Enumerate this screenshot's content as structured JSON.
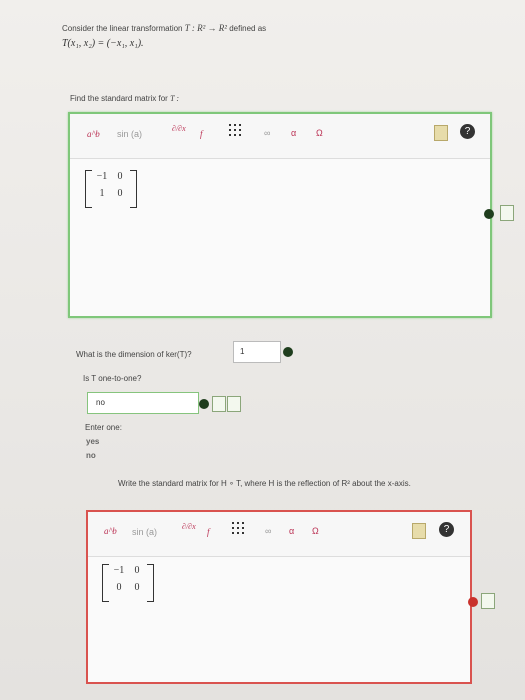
{
  "q1": {
    "intro": "Consider the linear transformation",
    "map": "T : R² → R²",
    "defined_as": "defined as",
    "rule": "T(x₁, x₂) = (−x₁, x₁)."
  },
  "q2": {
    "prompt": "Find the standard matrix for",
    "symbol": "T :"
  },
  "toolbar": {
    "power": "a^b",
    "sin": "sin (a)",
    "deriv": "∂/∂x",
    "f": "f",
    "infinity": "∞",
    "alpha": "α",
    "omega": "Ω",
    "help": "?"
  },
  "matrix1": {
    "r1c1": "−1",
    "r1c2": "0",
    "r2c1": "1",
    "r2c2": "0"
  },
  "q3": {
    "prompt": "What is the dimension of ker(T)?",
    "answer": "1"
  },
  "q4": {
    "prompt": "Is T one-to-one?",
    "answer": "no",
    "enter_one": "Enter one:",
    "opt_yes": "yes",
    "opt_no": "no"
  },
  "q5": {
    "prompt": "Write the standard matrix for H ∘ T, where H is the reflection of R² about the x-axis."
  },
  "matrix2": {
    "r1c1": "−1",
    "r1c2": "0",
    "r2c1": "0",
    "r2c2": "0"
  }
}
